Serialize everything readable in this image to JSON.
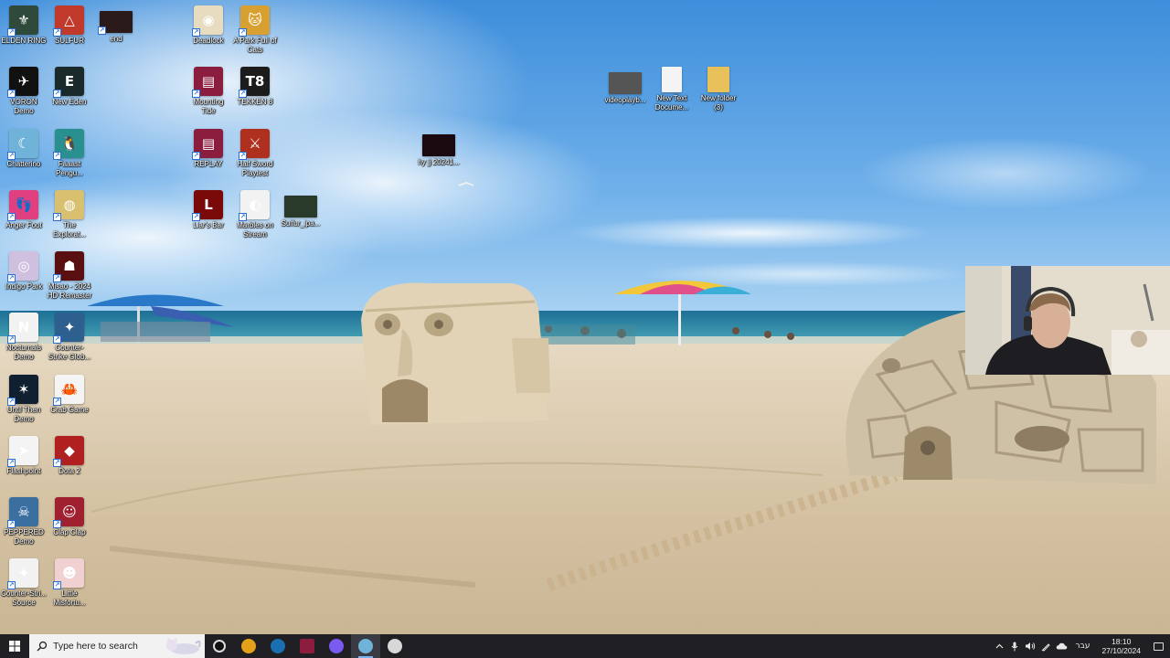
{
  "desktop_icons": [
    {
      "label": "ELDEN RING",
      "icon": "elden-ring-icon",
      "color": "#2f4a3a",
      "glyph": "⚜"
    },
    {
      "label": "SULFUR",
      "icon": "sulfur-icon",
      "color": "#c0392b",
      "glyph": "△"
    },
    {
      "label": "end",
      "icon": "video-icon",
      "color": "#2b1a1a",
      "glyph": ""
    },
    {
      "label": "Deadlock",
      "icon": "deadlock-icon",
      "color": "#e8dcc0",
      "glyph": "◉"
    },
    {
      "label": "A Park Full of Cats",
      "icon": "cats-icon",
      "color": "#d8a030",
      "glyph": "🐱"
    },
    {
      "label": "VORON Demo",
      "icon": "voron-icon",
      "color": "#111111",
      "glyph": "✈"
    },
    {
      "label": "New Eden",
      "icon": "new-eden-icon",
      "color": "#1a2a2a",
      "glyph": "E"
    },
    {
      "label": "Mounting Tide",
      "icon": "winrar-icon",
      "color": "#8b1e3f",
      "glyph": "▤"
    },
    {
      "label": "TEKKEN 8",
      "icon": "tekken-icon",
      "color": "#1c1c1c",
      "glyph": "T8"
    },
    {
      "label": "videoplayb...",
      "icon": "video-file-icon",
      "color": "#555555",
      "glyph": ""
    },
    {
      "label": "New Text Docume...",
      "icon": "text-file-icon",
      "color": "#f4f4f4",
      "glyph": ""
    },
    {
      "label": "New folder (3)",
      "icon": "folder-icon",
      "color": "#e8c15a",
      "glyph": ""
    },
    {
      "label": "Chatterino",
      "icon": "chatterino-icon",
      "color": "#6fb3d8",
      "glyph": "☾"
    },
    {
      "label": "Faaast Pengu...",
      "icon": "penguin-icon",
      "color": "#2a8f8f",
      "glyph": "🐧"
    },
    {
      "label": "REPLAY",
      "icon": "winrar-icon",
      "color": "#8b1e3f",
      "glyph": "▤"
    },
    {
      "label": "Half Sword Playtest",
      "icon": "half-sword-icon",
      "color": "#b03020",
      "glyph": "⚔"
    },
    {
      "label": "hy jj 20241...",
      "icon": "video-file-icon",
      "color": "#1a0a10",
      "glyph": ""
    },
    {
      "label": "Anger Foot",
      "icon": "anger-foot-icon",
      "color": "#e04080",
      "glyph": "👣"
    },
    {
      "label": "The Explorat...",
      "icon": "exploration-icon",
      "color": "#d8c070",
      "glyph": "◍"
    },
    {
      "label": "Liar's Bar",
      "icon": "liars-bar-icon",
      "color": "#7a0a0a",
      "glyph": "L"
    },
    {
      "label": "Marbles on Stream",
      "icon": "marbles-icon",
      "color": "#f2f2f2",
      "glyph": "◐"
    },
    {
      "label": "Sulfur_ipa...",
      "icon": "video-file-icon",
      "color": "#2a3a2a",
      "glyph": ""
    },
    {
      "label": "Indigo Park",
      "icon": "indigo-park-icon",
      "color": "#d0c0e0",
      "glyph": "◎"
    },
    {
      "label": "Misao - 2024 HD Remaster",
      "icon": "misao-icon",
      "color": "#5a1010",
      "glyph": "☗"
    },
    {
      "label": "Nocturnals Demo",
      "icon": "nocturnals-icon",
      "color": "#f2f2f2",
      "glyph": "N"
    },
    {
      "label": "Counter-Strike Glob...",
      "icon": "csgo-icon",
      "color": "#2d5f8f",
      "glyph": "✦"
    },
    {
      "label": "Until Then Demo",
      "icon": "until-then-icon",
      "color": "#102030",
      "glyph": "✶"
    },
    {
      "label": "Crab Game",
      "icon": "crab-game-icon",
      "color": "#f4f4f4",
      "glyph": "🦀"
    },
    {
      "label": "Flashpoint",
      "icon": "flashpoint-icon",
      "color": "#f4f4f4",
      "glyph": "➤"
    },
    {
      "label": "Dota 2",
      "icon": "dota-icon",
      "color": "#b02020",
      "glyph": "◆"
    },
    {
      "label": "PEPPERED Demo",
      "icon": "peppered-icon",
      "color": "#3a6fa0",
      "glyph": "☠"
    },
    {
      "label": "Clap Clap",
      "icon": "clap-clap-icon",
      "color": "#a02030",
      "glyph": "☺"
    },
    {
      "label": "Counter-Stri... Source",
      "icon": "css-icon",
      "color": "#f2f2f2",
      "glyph": "✦"
    },
    {
      "label": "Little Misfortu...",
      "icon": "little-misfortune-icon",
      "color": "#f0d0d0",
      "glyph": "☻"
    }
  ],
  "taskbar": {
    "search_placeholder": "Type here to search",
    "apps": [
      {
        "name": "task-view-icon",
        "color": "#2a2a2a"
      },
      {
        "name": "chrome-icon",
        "color": "#e3a21a"
      },
      {
        "name": "steam-icon",
        "color": "#1b6fb0"
      },
      {
        "name": "winrar-icon",
        "color": "#8b1e3f"
      },
      {
        "name": "discord-icon",
        "color": "#7a5af0"
      },
      {
        "name": "chatterino-icon",
        "color": "#6fb3d8"
      },
      {
        "name": "obs-icon",
        "color": "#d8d8d8"
      }
    ],
    "tray": {
      "language": "עבר",
      "time": "18:10",
      "date": "27/10/2024"
    }
  }
}
